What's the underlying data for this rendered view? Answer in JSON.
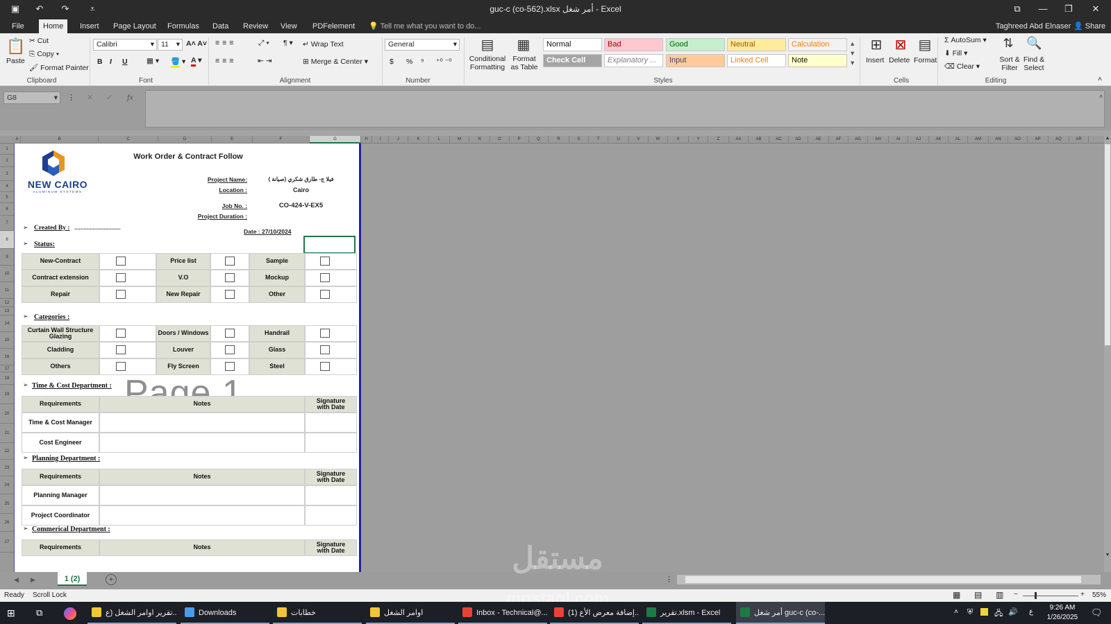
{
  "window": {
    "title": "guc-c (co-562).xlsx  أمر شغل - Excel",
    "controls": [
      "ribbon-display",
      "minimize",
      "restore",
      "close"
    ]
  },
  "quick_access": {
    "save": "save-icon",
    "undo": "undo-icon",
    "redo": "redo-icon",
    "customize": "customize-icon"
  },
  "menu_tabs": [
    "File",
    "Home",
    "Insert",
    "Page Layout",
    "Formulas",
    "Data",
    "Review",
    "View",
    "PDFelement"
  ],
  "tell_me": "Tell me what you want to do...",
  "user": {
    "name": "Taghreed Abd Elnaser",
    "share": "Share"
  },
  "ribbon": {
    "clipboard": {
      "paste": "Paste",
      "cut": "Cut",
      "copy": "Copy",
      "format_painter": "Format Painter",
      "label": "Clipboard"
    },
    "font": {
      "family": "Calibri",
      "size": "11",
      "bold": "B",
      "italic": "I",
      "underline": "U",
      "label": "Font"
    },
    "alignment": {
      "wrap": "Wrap Text",
      "merge": "Merge & Center",
      "label": "Alignment"
    },
    "number": {
      "format": "General",
      "currency": "$",
      "percent": "%",
      "comma": "⁹",
      "label": "Number"
    },
    "styles": {
      "conditional": "Conditional Formatting",
      "format_table": "Format as Table",
      "cells": [
        {
          "text": "Normal",
          "bg": "#ffffff",
          "fg": "#111111"
        },
        {
          "text": "Bad",
          "bg": "#ffc7ce",
          "fg": "#9c0006"
        },
        {
          "text": "Good",
          "bg": "#c6efce",
          "fg": "#006100"
        },
        {
          "text": "Neutral",
          "bg": "#ffeb9c",
          "fg": "#9c5700"
        },
        {
          "text": "Calculation",
          "bg": "#f2f2f2",
          "fg": "#fa7d00"
        },
        {
          "text": "Check Cell",
          "bg": "#a5a5a5",
          "fg": "#ffffff"
        },
        {
          "text": "Explanatory ...",
          "bg": "#ffffff",
          "fg": "#7f7f7f"
        },
        {
          "text": "Input",
          "bg": "#ffcc99",
          "fg": "#3f3f76"
        },
        {
          "text": "Linked Cell",
          "bg": "#ffffff",
          "fg": "#fa7d00"
        },
        {
          "text": "Note",
          "bg": "#ffffcc",
          "fg": "#111111"
        }
      ],
      "label": "Styles"
    },
    "cells": {
      "insert": "Insert",
      "delete": "Delete",
      "format": "Format",
      "label": "Cells"
    },
    "editing": {
      "autosum": "AutoSum",
      "fill": "Fill",
      "clear": "Clear",
      "sort": "Sort & Filter",
      "find": "Find & Select",
      "label": "Editing"
    }
  },
  "formula_bar": {
    "name_box": "G8",
    "fx": "fx",
    "value": ""
  },
  "columns": [
    "A",
    "B",
    "C",
    "D",
    "E",
    "F",
    "G",
    "H",
    "I",
    "J",
    "K",
    "L",
    "M",
    "N",
    "O",
    "P",
    "Q",
    "R",
    "S",
    "T",
    "U",
    "V",
    "W",
    "X",
    "Y",
    "Z",
    "AA",
    "AB",
    "AC",
    "AD",
    "AE",
    "AF",
    "AG",
    "AH",
    "AI",
    "AJ",
    "AK",
    "AL",
    "AM",
    "AN",
    "AO",
    "AP",
    "AQ",
    "AR"
  ],
  "rows": [
    "1",
    "2",
    "3",
    "4",
    "5",
    "6",
    "7",
    "8",
    "9",
    "10",
    "11",
    "12",
    "13",
    "14",
    "15",
    "16",
    "17",
    "18",
    "19",
    "20",
    "21",
    "22",
    "23",
    "24",
    "25",
    "26",
    "27"
  ],
  "sheet": {
    "logo": {
      "name": "NEW CAIRO",
      "tagline": "ALUMINUM SYSTEMS"
    },
    "title": "Work Order & Contract Follow",
    "project_name_label": "Project Name:",
    "project_name": "فيلا ج- طارق شكري (صيانة )",
    "location_label": "Location   :",
    "location": "Cairo",
    "job_no_label": "Job No. :",
    "job_no": "CO-424-V-EX5",
    "duration_label": "Project Duration :",
    "created_by": "Created By :",
    "created_dots": "..............................",
    "date": "Date : 27/10/2024",
    "status_label": "Status:",
    "status_rows": [
      [
        "New-Contract",
        "Price list",
        "Sample"
      ],
      [
        "Contract extension",
        "V.O",
        "Mockup"
      ],
      [
        "Repair",
        "New Repair",
        "Other"
      ]
    ],
    "categories_label": "Categories :",
    "category_rows": [
      [
        "Curtain Wall Structure Glazing",
        "Doors / Windows",
        "Handrail"
      ],
      [
        "Cladding",
        "Louver",
        "Glass"
      ],
      [
        "Others",
        "Fly Screen",
        "Steel"
      ]
    ],
    "page_watermark": "Page 1",
    "departments": [
      {
        "label": "Time & Cost  Department :",
        "requirements": "Requirements",
        "notes": "Notes",
        "signature": "Signature with Date",
        "roles": [
          "Time & Cost Manager",
          "Cost Engineer"
        ]
      },
      {
        "label": "Planning Department :",
        "requirements": "Requirements",
        "notes": "Notes",
        "signature": "Signature with Date",
        "roles": [
          "Planning Manager",
          "Project Coordinator"
        ]
      },
      {
        "label": "Commerical  Department :",
        "requirements": "Requirements",
        "notes": "Notes",
        "signature": "Signature with Date",
        "roles": []
      }
    ]
  },
  "sheet_tabs": [
    "1 (2)"
  ],
  "status_bar": {
    "ready": "Ready",
    "scroll_lock": "Scroll Lock",
    "zoom": "55%"
  },
  "watermark": {
    "arabic": "مستقل",
    "latin": "mostaql.com"
  },
  "taskbar": {
    "items": [
      "تقرير اوامر الشغل (ع...",
      "Downloads",
      "خطابات",
      "اوامر الشغل",
      "Inbox - Technical@...",
      "إضافة معرض الأع (1)...",
      "تقرير.xlsm - Excel",
      "أمر شغل guc-c (co-..."
    ],
    "time": "9:26 AM",
    "date": "1/26/2025",
    "lang": "ع"
  }
}
